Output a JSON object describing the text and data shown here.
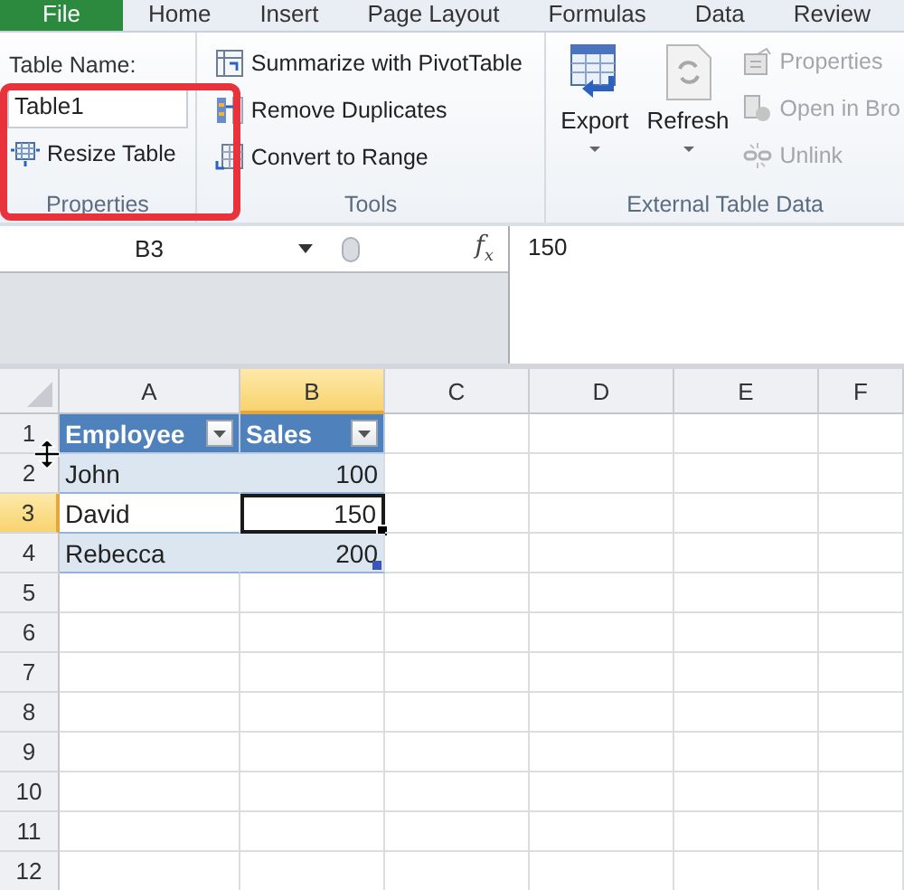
{
  "tabs": [
    {
      "label": "File",
      "kind": "file",
      "selected": false
    },
    {
      "label": "Home",
      "kind": "tab",
      "selected": false
    },
    {
      "label": "Insert",
      "kind": "tab",
      "selected": false
    },
    {
      "label": "Page Layout",
      "kind": "tab",
      "selected": false
    },
    {
      "label": "Formulas",
      "kind": "tab",
      "selected": false
    },
    {
      "label": "Data",
      "kind": "tab",
      "selected": false
    },
    {
      "label": "Review",
      "kind": "tab",
      "selected": false
    }
  ],
  "ribbon": {
    "properties": {
      "name_label": "Table Name:",
      "name_value": "Table1",
      "resize_button": "Resize Table",
      "label": "Properties",
      "highlighted": true
    },
    "tools": {
      "items": [
        {
          "label": "Summarize with PivotTable",
          "kind": "pivot"
        },
        {
          "label": "Remove Duplicates",
          "kind": "dedupe"
        },
        {
          "label": "Convert to Range",
          "kind": "convert"
        }
      ],
      "label": "Tools"
    },
    "external": {
      "big_buttons": [
        {
          "label": "Export",
          "kind": "export",
          "disabled": false
        },
        {
          "label": "Refresh",
          "kind": "refresh",
          "disabled": false
        }
      ],
      "small_buttons": [
        {
          "label": "Properties",
          "kind": "properties",
          "disabled": true
        },
        {
          "label": "Open in Bro",
          "kind": "browser",
          "disabled": true
        },
        {
          "label": "Unlink",
          "kind": "unlink",
          "disabled": true
        }
      ],
      "label": "External Table Data"
    }
  },
  "formula_bar": {
    "name_box": "B3",
    "fx_label": "f$_{x}$",
    "formula": "150"
  },
  "sheet": {
    "columns": [
      {
        "label": "A",
        "selected": false
      },
      {
        "label": "B",
        "selected": true
      },
      {
        "label": "C",
        "selected": false
      },
      {
        "label": "D",
        "selected": false
      },
      {
        "label": "E",
        "selected": false
      },
      {
        "label": "F",
        "selected": false
      }
    ],
    "rows": [
      {
        "label": "1",
        "selected": false,
        "cells": [
          {
            "text": "Employee",
            "kind": "header",
            "active": false
          },
          {
            "text": "Sales",
            "kind": "header",
            "active": false
          }
        ]
      },
      {
        "label": "2",
        "selected": false,
        "banded": true,
        "cells": [
          {
            "text": "John",
            "kind": "text",
            "active": false
          },
          {
            "text": "100",
            "kind": "number",
            "active": false
          }
        ]
      },
      {
        "label": "3",
        "selected": true,
        "banded": false,
        "cells": [
          {
            "text": "David",
            "kind": "text",
            "active": false
          },
          {
            "text": "150",
            "kind": "number",
            "active": true
          }
        ]
      },
      {
        "label": "4",
        "selected": false,
        "banded": true,
        "cells": [
          {
            "text": "Rebecca",
            "kind": "text",
            "active": false
          },
          {
            "text": "200",
            "kind": "number",
            "active": false
          }
        ]
      },
      {
        "label": "5",
        "selected": false
      },
      {
        "label": "6",
        "selected": false
      },
      {
        "label": "7",
        "selected": false
      },
      {
        "label": "8",
        "selected": false
      },
      {
        "label": "9",
        "selected": false
      },
      {
        "label": "10",
        "selected": false
      },
      {
        "label": "11",
        "selected": false
      },
      {
        "label": "12",
        "selected": false
      }
    ]
  }
}
